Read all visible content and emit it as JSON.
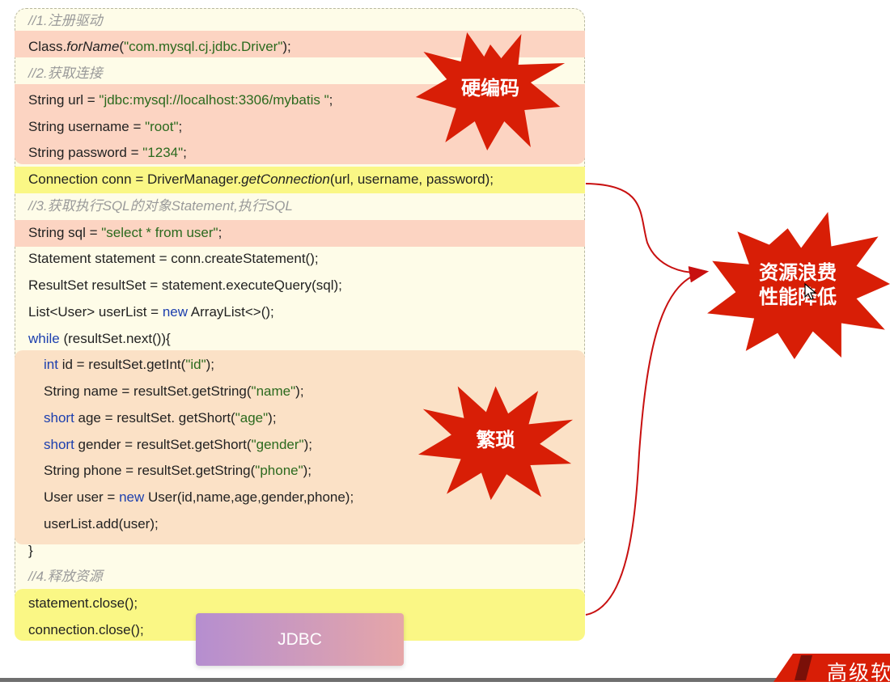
{
  "code": {
    "comment1": "//1.注册驱动",
    "line_class": [
      "Class.",
      "forName",
      "(",
      "\"com.mysql.cj.jdbc.Driver\"",
      ");"
    ],
    "comment2": "//2.获取连接",
    "line_url": [
      "String url = ",
      "\"jdbc:mysql://localhost:3306/mybatis \"",
      ";"
    ],
    "line_username": [
      "String username = ",
      "\"root\"",
      ";"
    ],
    "line_password": [
      "String password = ",
      "\"1234\"",
      ";"
    ],
    "line_conn": [
      "Connection conn = DriverManager.",
      "getConnection",
      "(url, username, password);"
    ],
    "comment3": "//3.获取执行SQL的对象Statement,执行SQL",
    "line_sql": [
      "String sql = ",
      "\"select * from user\"",
      ";"
    ],
    "line_statement": "Statement statement = conn.createStatement();",
    "line_resultset": "ResultSet resultSet = statement.executeQuery(sql);",
    "line_list": [
      "List<User> userList = ",
      "new",
      " ArrayList<>();"
    ],
    "line_while": [
      "while",
      " (resultSet.next()){"
    ],
    "line_id": [
      "int",
      " id = resultSet.getInt(",
      "\"id\"",
      ");"
    ],
    "line_name": [
      "String name = resultSet.getString(",
      "\"name\"",
      ");"
    ],
    "line_age": [
      "short",
      " age = resultSet. getShort(",
      "\"age\"",
      ");"
    ],
    "line_gender": [
      "short",
      " gender = resultSet.getShort(",
      "\"gender\"",
      ");"
    ],
    "line_phone": [
      "String phone = resultSet.getString(",
      "\"phone\"",
      ");"
    ],
    "line_user": [
      "User user = ",
      "new",
      " User(id,name,age,gender,phone);"
    ],
    "line_add": "userList.add(user);",
    "line_close_brace": "}",
    "comment4": "//4.释放资源",
    "line_stmt_close": "statement.close();",
    "line_conn_close": "connection.close();"
  },
  "bursts": {
    "hardcode": "硬编码",
    "tedious": "繁琐",
    "waste": "资源浪费\n性能降低"
  },
  "caption": "JDBC",
  "brand": "高级软",
  "colors": {
    "burst_red": "#d81e06",
    "arrow_red": "#c81010",
    "string_green": "#2b6a1e",
    "keyword_blue": "#1c3fae"
  }
}
